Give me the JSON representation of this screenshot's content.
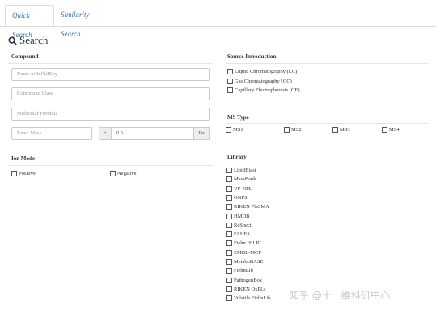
{
  "tabs": {
    "quick": "Quick Search",
    "similarity": "Similarity Search"
  },
  "search_title": "Search",
  "compound": {
    "heading": "Compound",
    "name_placeholder": "Name or InChIKey",
    "class_placeholder": "Compound Class",
    "formula_placeholder": "Molecular Formula",
    "mass_placeholder": "Exact Mass",
    "tolerance_symbol": "±",
    "tolerance_value": "0.5",
    "unit": "Da"
  },
  "ion_mode": {
    "heading": "Ion Mode",
    "positive": "Positive",
    "negative": "Negative"
  },
  "source": {
    "heading": "Source Introduction",
    "options": [
      "Liquid Chromatography (LC)",
      "Gas Chromatography (GC)",
      "Capillary Electrophoresis (CE)"
    ]
  },
  "ms_type": {
    "heading": "MS Type",
    "options": [
      "MS1",
      "MS2",
      "MS3",
      "MS4"
    ]
  },
  "library": {
    "heading": "Library",
    "options": [
      "LipidBlast",
      "MassBank",
      "VF-NPL",
      "GNPS",
      "RIKEN PlaSMA",
      "HMDB",
      "ReSpect",
      "FAHFA",
      "Fiehn HILIC",
      "EMBL-MCF",
      "MetaboBASE",
      "FiehnLib",
      "PathogenBox",
      "RIKEN OxPLs",
      "Volatile FiehnLib"
    ]
  },
  "watermark": "知乎 @十一维科研中心"
}
